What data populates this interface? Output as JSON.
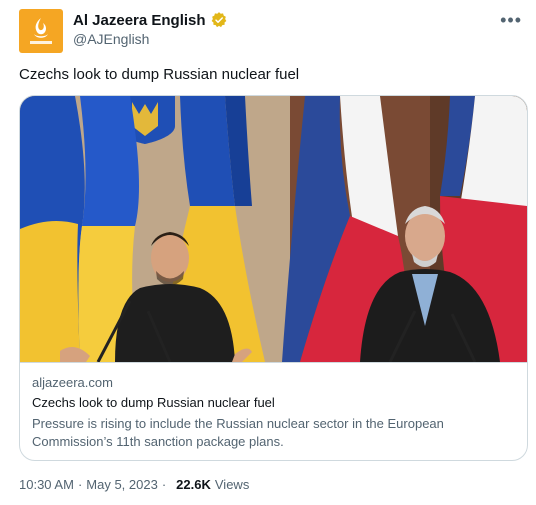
{
  "account": {
    "display_name": "Al Jazeera English",
    "handle": "@AJEnglish",
    "verified_icon": "gold-verified-badge-icon",
    "avatar_color": "#f5a623"
  },
  "tweet": {
    "text": "Czechs look to dump Russian nuclear fuel"
  },
  "card": {
    "domain": "aljazeera.com",
    "title": "Czechs look to dump Russian nuclear fuel",
    "description": "Pressure is rising to include the Russian nuclear sector in the European Commission’s 11th sanction package plans."
  },
  "meta": {
    "time": "10:30 AM",
    "separator": "·",
    "date": "May 5, 2023",
    "views_count": "22.6K",
    "views_label": "Views"
  },
  "menu": {
    "more_label": "•••"
  },
  "colors": {
    "text_primary": "#0f1419",
    "text_secondary": "#536471",
    "border": "#cfd9de",
    "ua_blue": "#1f4fb5",
    "ua_yellow": "#f2c230",
    "cz_red": "#d7263d",
    "cz_blue": "#2b4a9a"
  }
}
